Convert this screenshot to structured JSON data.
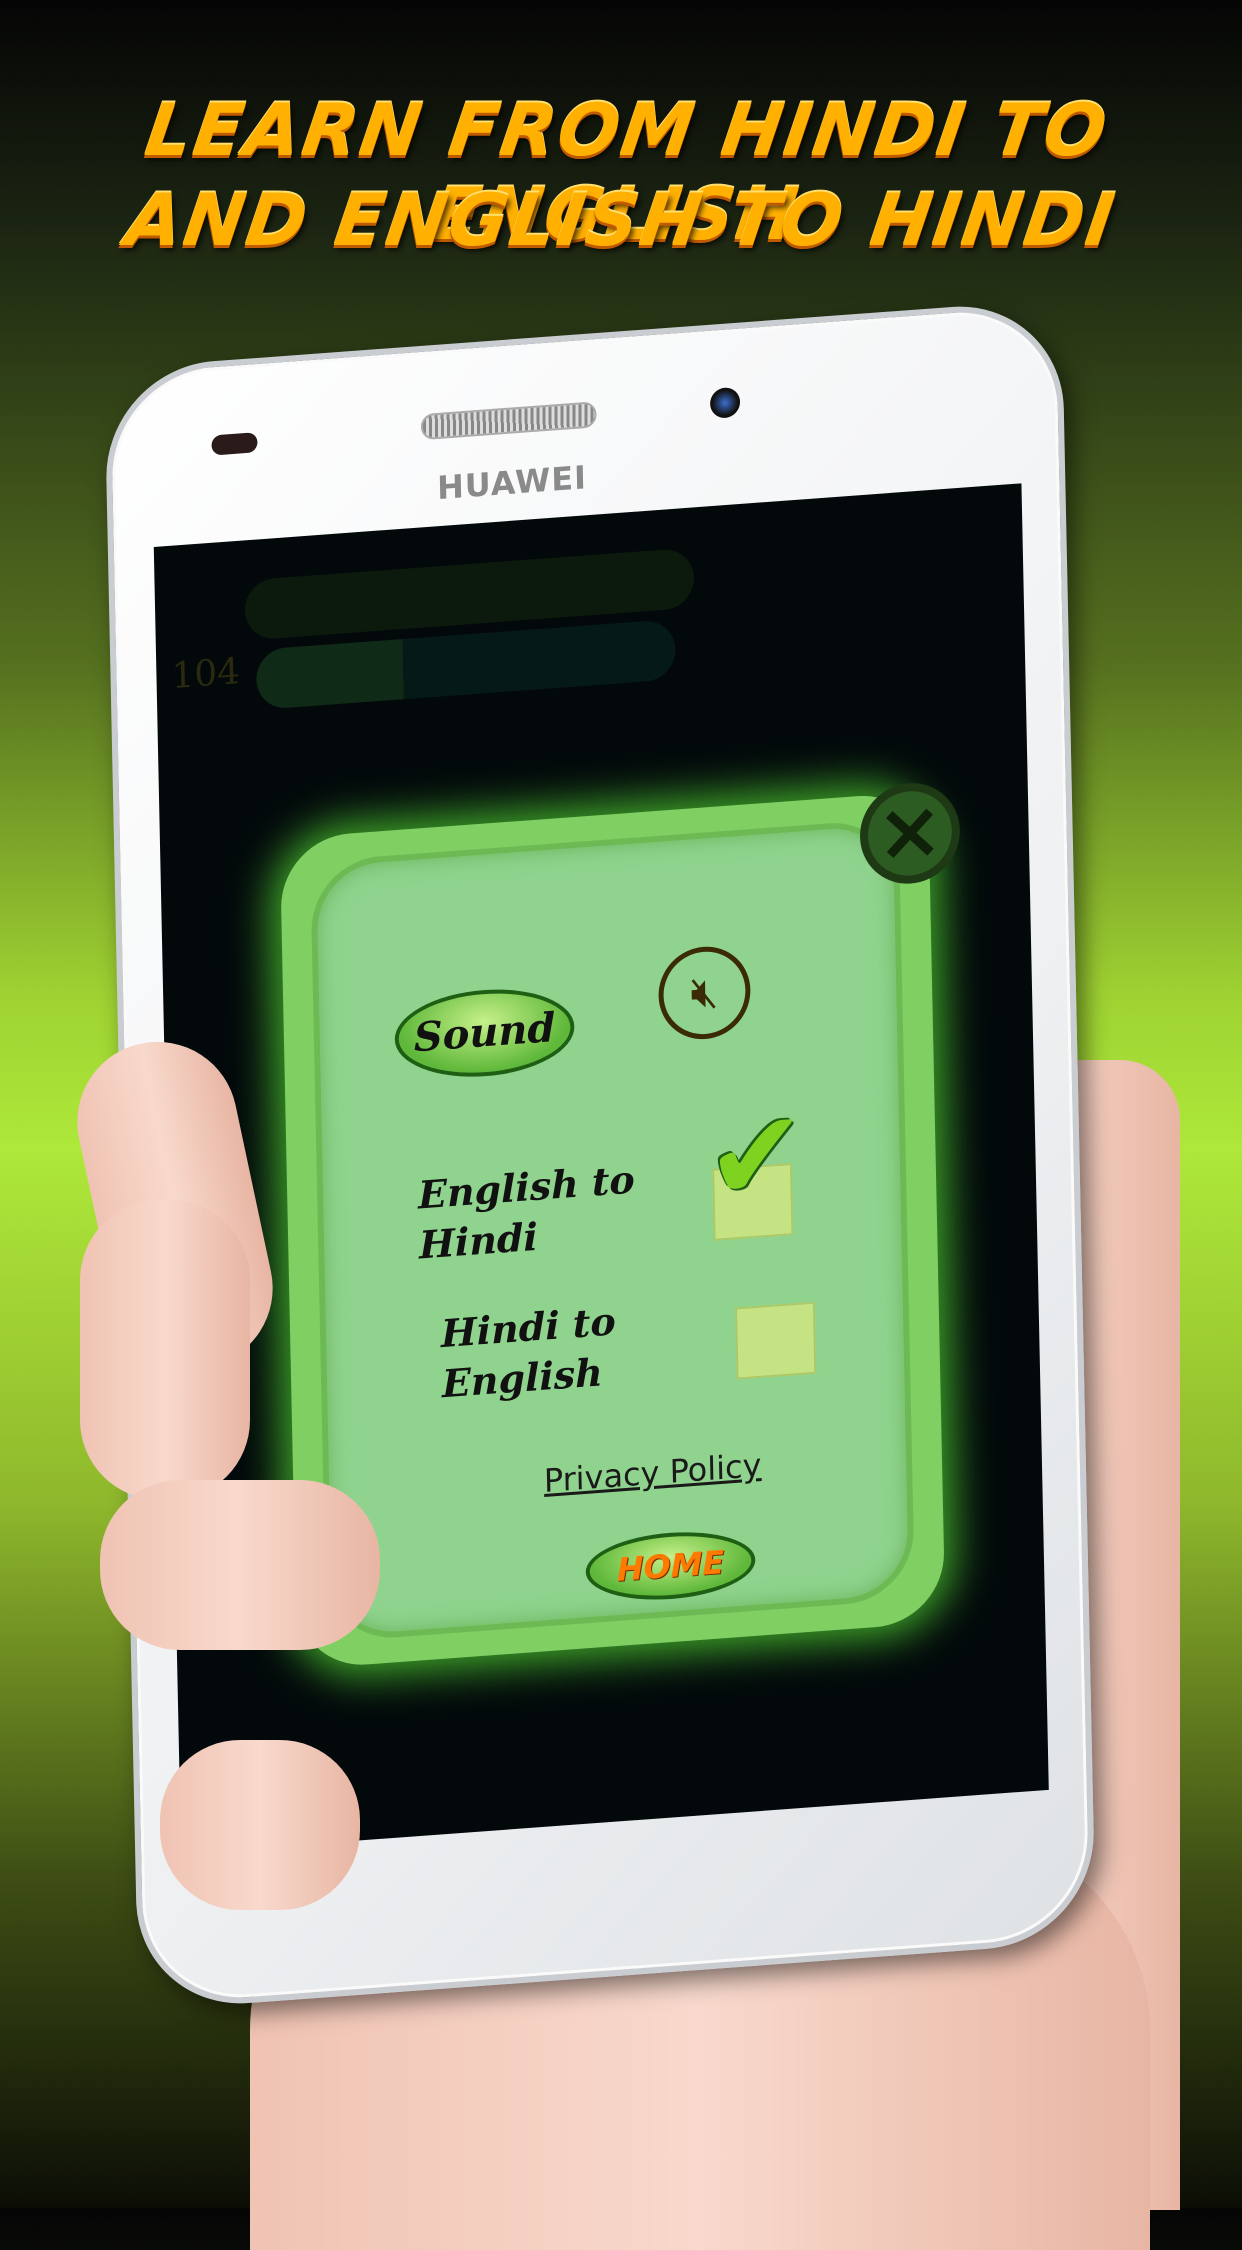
{
  "headline": {
    "line1": "Learn from Hindi to English",
    "line2": "and English to Hindi"
  },
  "phone": {
    "brand": "HUAWEI"
  },
  "background_game": {
    "level": "104"
  },
  "dialog": {
    "sound_label": "Sound",
    "sound_state": "muted",
    "options": [
      {
        "label_line1": "English to",
        "label_line2": "Hindi",
        "checked": true
      },
      {
        "label_line1": "Hindi to",
        "label_line2": "English",
        "checked": false
      }
    ],
    "privacy_link": "Privacy Policy",
    "home_label": "HOME"
  },
  "colors": {
    "headline": "#ffb000",
    "panel": "#8fd38e",
    "home_text": "#ff7a00"
  }
}
